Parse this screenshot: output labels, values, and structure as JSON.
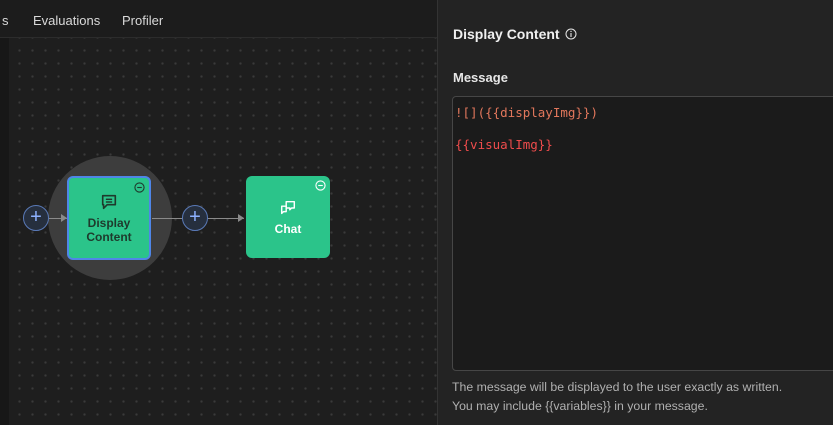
{
  "tabs": {
    "partial": "s",
    "evaluations": "Evaluations",
    "profiler": "Profiler"
  },
  "canvas": {
    "nodes": [
      {
        "label_line1": "Display",
        "label_line2": "Content",
        "icon": "message-square-icon",
        "color": "#2bc48a",
        "selected": true
      },
      {
        "label": "Chat",
        "icon": "chat-bubbles-icon",
        "color": "#2bc48a"
      }
    ],
    "add_button_label": "+"
  },
  "panel": {
    "title": "Display Content",
    "title_icon": "info-icon",
    "message_label": "Message",
    "message_lines": [
      "![]({{displayImg}})",
      "",
      "{{visualImg}}"
    ],
    "help_line_1": "The message will be displayed to the user exactly as written.",
    "help_line_2": "You may include {{variables}} in your message."
  },
  "colors": {
    "accent_blue": "#4f86e8",
    "node_green": "#2bc48a",
    "code_orange": "#e2775c",
    "code_red": "#ef4c4c"
  }
}
